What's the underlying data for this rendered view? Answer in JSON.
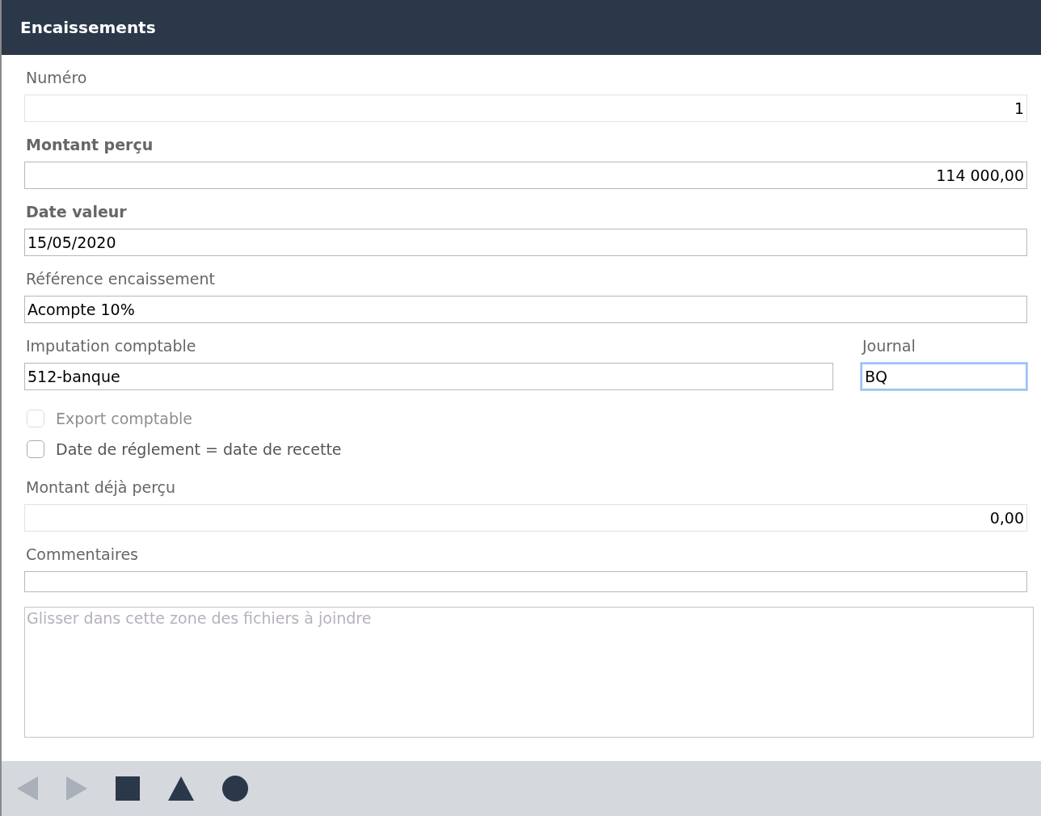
{
  "window": {
    "title": "Encaissements"
  },
  "fields": [
    {
      "kind": "amount",
      "label": "Numéro",
      "value": "1",
      "bold": false,
      "readonly": true
    },
    {
      "kind": "amount",
      "label": "Montant perçu",
      "value": "114 000,00",
      "bold": true,
      "readonly": false
    },
    {
      "kind": "field",
      "label": "Date valeur",
      "value": "15/05/2020",
      "bold": true,
      "readonly": false
    },
    {
      "kind": "field",
      "label": "Référence encaissement",
      "value": "Acompte 10%",
      "bold": false,
      "readonly": false
    },
    {
      "kind": "pair",
      "items": [
        {
          "label": "Imputation comptable",
          "value": "512-banque",
          "focused": false
        },
        {
          "label": "Journal",
          "value": "BQ",
          "focused": true
        }
      ]
    },
    {
      "kind": "checkbox",
      "label": "Export comptable",
      "checked": false,
      "disabled": true
    },
    {
      "kind": "checkbox",
      "label": "Date de réglement = date de recette",
      "checked": false,
      "disabled": false
    },
    {
      "kind": "amount",
      "label": "Montant déjà perçu",
      "value": "0,00",
      "bold": false,
      "readonly": true
    },
    {
      "kind": "comment",
      "label": "Commentaires"
    },
    {
      "kind": "dropzone",
      "placeholder": "Glisser dans cette zone des fichiers à joindre"
    }
  ],
  "toolbar": [
    {
      "kind": "prev",
      "disabled": true
    },
    {
      "kind": "next",
      "disabled": true
    },
    {
      "kind": "square",
      "disabled": false
    },
    {
      "kind": "triangle",
      "disabled": false
    },
    {
      "kind": "circle",
      "disabled": false
    }
  ]
}
